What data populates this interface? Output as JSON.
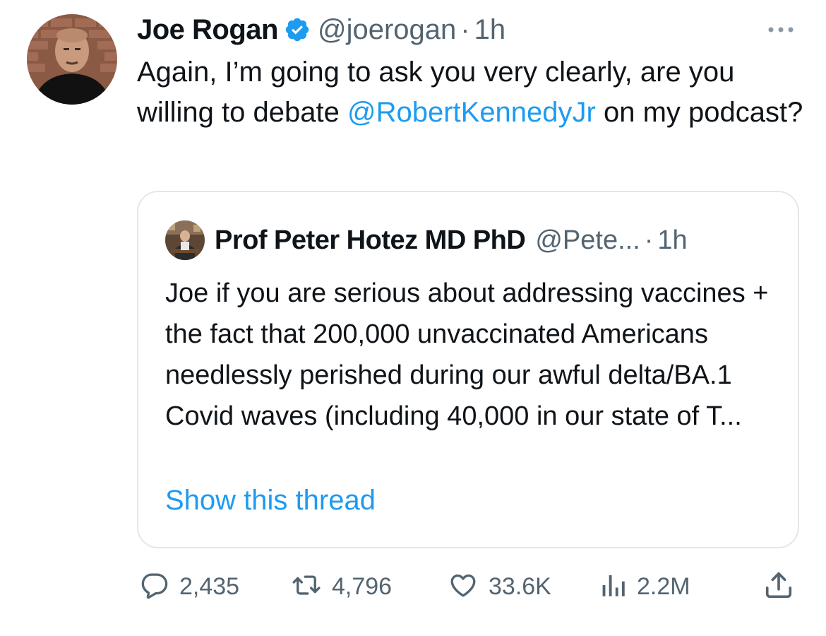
{
  "author": {
    "name": "Joe Rogan",
    "handle": "@joerogan",
    "separator": "·",
    "time": "1h",
    "verified": true,
    "verified_color": "#1d9bf0"
  },
  "tweet": {
    "text_before": "Again, I’m going to ask you very clearly, are you willing to debate ",
    "mention": "@RobertKennedyJr",
    "text_after": " on my podcast?"
  },
  "quote": {
    "name": "Prof Peter Hotez MD PhD",
    "handle": "@Pete...",
    "separator": "·",
    "time": "1h",
    "text": "Joe if you are serious about addressing vaccines + the fact that 200,000 unvaccinated Americans needlessly perished during our awful delta/BA.1 Covid waves (including 40,000 in our state of T...",
    "show_thread": "Show this thread"
  },
  "actions": {
    "replies": "2,435",
    "retweets": "4,796",
    "likes": "33.6K",
    "views": "2.2M"
  },
  "icons": {
    "more": "more-dots-icon",
    "reply": "reply-icon",
    "retweet": "retweet-icon",
    "like": "heart-icon",
    "views": "views-chart-icon",
    "share": "share-icon"
  },
  "colors": {
    "link": "#1d9bf0",
    "secondary_text": "#536471",
    "primary_text": "#0f1419",
    "border": "#e4e7ea"
  }
}
